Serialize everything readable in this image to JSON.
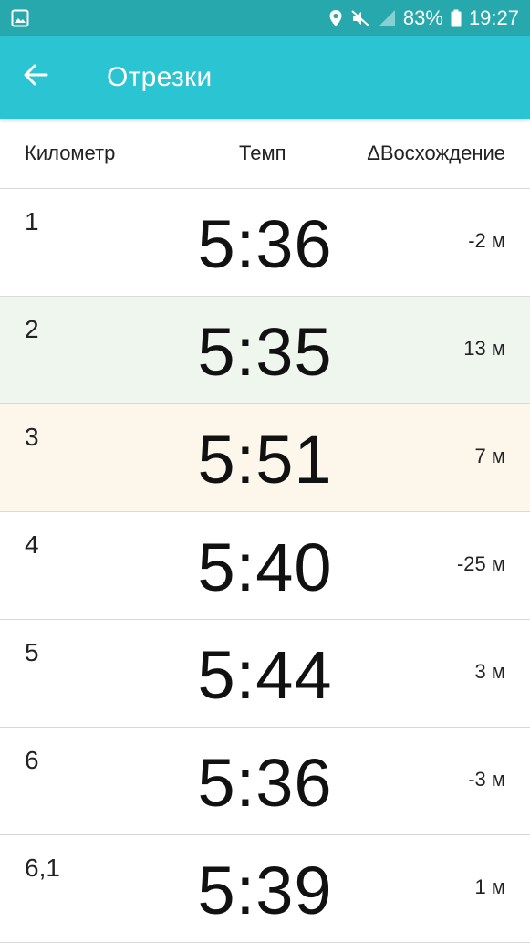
{
  "status_bar": {
    "battery": "83%",
    "time": "19:27",
    "icons": [
      "image-icon",
      "location-icon",
      "mute-icon",
      "signal-icon",
      "battery-icon"
    ]
  },
  "app_bar": {
    "title": "Отрезки",
    "back_icon": "arrow-left-icon",
    "color": "#2bc4d2"
  },
  "table": {
    "headers": {
      "km": "Километр",
      "pace": "Темп",
      "elevation": "ΔВосхождение"
    },
    "rows": [
      {
        "km": "1",
        "pace": "5:36",
        "elevation": "-2 м",
        "highlight": "#ffffff"
      },
      {
        "km": "2",
        "pace": "5:35",
        "elevation": "13 м",
        "highlight": "#eef6ee"
      },
      {
        "km": "3",
        "pace": "5:51",
        "elevation": "7 м",
        "highlight": "#fdf6ea"
      },
      {
        "km": "4",
        "pace": "5:40",
        "elevation": "-25 м",
        "highlight": "#ffffff"
      },
      {
        "km": "5",
        "pace": "5:44",
        "elevation": "3 м",
        "highlight": "#ffffff"
      },
      {
        "km": "6",
        "pace": "5:36",
        "elevation": "-3 м",
        "highlight": "#ffffff"
      },
      {
        "km": "6,1",
        "pace": "5:39",
        "elevation": "1 м",
        "highlight": "#ffffff"
      }
    ]
  }
}
